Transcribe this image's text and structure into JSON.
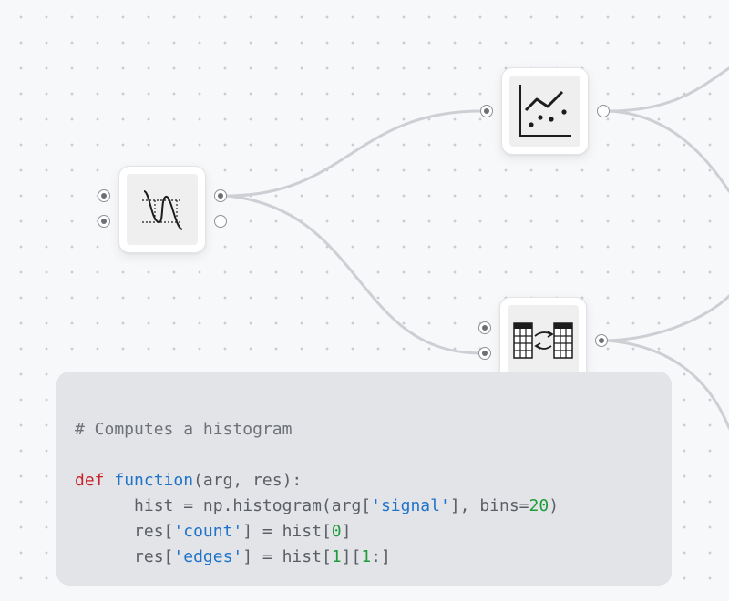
{
  "canvas": {
    "background": "#f7f8fa",
    "edge_color": "#cdcfd4"
  },
  "nodes": [
    {
      "id": "signal",
      "icon": "signal-wave-icon",
      "inputs": [
        {
          "connected": true
        },
        {
          "connected": true
        }
      ],
      "outputs": [
        {
          "connected": true
        },
        {
          "connected": false
        }
      ]
    },
    {
      "id": "plot",
      "icon": "scatter-line-chart-icon",
      "inputs": [
        {
          "connected": true
        }
      ],
      "outputs": [
        {
          "connected": false
        }
      ]
    },
    {
      "id": "table",
      "icon": "table-transform-icon",
      "inputs": [
        {
          "connected": true
        },
        {
          "connected": true
        }
      ],
      "outputs": [
        {
          "connected": true
        }
      ]
    }
  ],
  "code": {
    "comment": "# Computes a histogram",
    "line1": {
      "kw": "def",
      "fn": "function",
      "rest": "(arg, res):"
    },
    "line2": {
      "a": "hist = np.histogram(arg[",
      "str": "'signal'",
      "b": "], bins=",
      "num": "20",
      "c": ")"
    },
    "line3": {
      "a": "res[",
      "str": "'count'",
      "b": "] = hist[",
      "num": "0",
      "c": "]"
    },
    "line4": {
      "a": "res[",
      "str": "'edges'",
      "b": "] = hist[",
      "num1": "1",
      "c": "][",
      "num2": "1",
      "d": ":]"
    }
  }
}
